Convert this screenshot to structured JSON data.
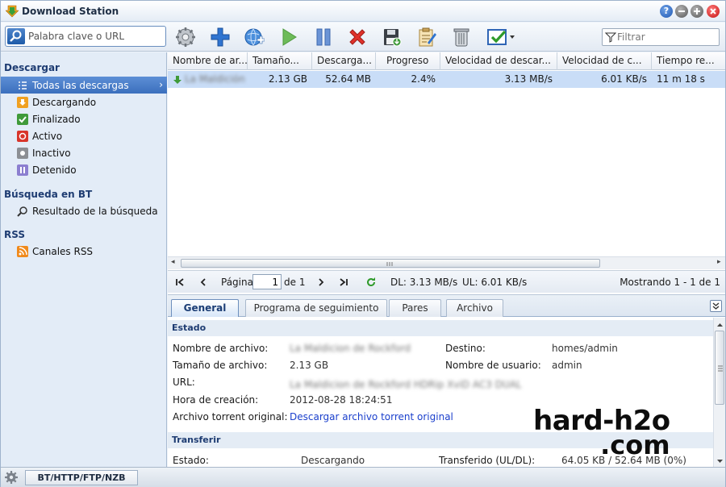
{
  "app": {
    "title": "Download Station"
  },
  "window_controls": {
    "help": "?"
  },
  "toolbar": {
    "search_placeholder": "Palabra clave o URL",
    "filter_placeholder": "Filtrar",
    "buttons": [
      "settings-icon",
      "add-icon",
      "add-url-icon",
      "resume-icon",
      "pause-icon",
      "delete-icon",
      "save-icon",
      "edit-icon",
      "clear-icon",
      "select-icon"
    ]
  },
  "sidebar": {
    "download_heading": "Descargar",
    "download_items": [
      {
        "label": "Todas las descargas",
        "icon": "list-icon",
        "selected": true
      },
      {
        "label": "Descargando",
        "icon": "downloading-icon"
      },
      {
        "label": "Finalizado",
        "icon": "finished-icon"
      },
      {
        "label": "Activo",
        "icon": "active-icon"
      },
      {
        "label": "Inactivo",
        "icon": "inactive-icon"
      },
      {
        "label": "Detenido",
        "icon": "stopped-icon"
      }
    ],
    "bt_heading": "Búsqueda en BT",
    "bt_items": [
      {
        "label": "Resultado de la búsqueda",
        "icon": "search-icon"
      }
    ],
    "rss_heading": "RSS",
    "rss_items": [
      {
        "label": "Canales RSS",
        "icon": "rss-icon"
      }
    ]
  },
  "table": {
    "columns": [
      "Nombre de ar...",
      "Tamaño...",
      "Descarga...",
      "Progreso",
      "Velocidad de descar...",
      "Velocidad de c...",
      "Tiempo re..."
    ],
    "rows": [
      {
        "name": "La Maldición",
        "size": "2.13 GB",
        "downloaded": "52.64 MB",
        "progress": "2.4%",
        "download_speed": "3.13 MB/s",
        "upload_speed": "6.01 KB/s",
        "time_left": "11 m 18 s"
      }
    ]
  },
  "pager": {
    "page_label": "Página",
    "page_value": "1",
    "of_label": "de 1",
    "dl_speed": "DL: 3.13 MB/s",
    "ul_speed": "UL: 6.01 KB/s",
    "showing": "Mostrando 1 - 1 de 1"
  },
  "details": {
    "tabs": [
      "General",
      "Programa de seguimiento",
      "Pares",
      "Archivo"
    ],
    "estado_heading": "Estado",
    "file_name_label": "Nombre de archivo:",
    "file_name_value": "La Maldicion de Rockford",
    "size_label": "Tamaño de archivo:",
    "size_value": "2.13 GB",
    "url_label": "URL:",
    "url_value": "La Maldicion de Rockford HDRip XviD AC3 DUAL",
    "created_label": "Hora de creación:",
    "created_value": "2012-08-28 18:24:51",
    "torrent_label": "Archivo torrent original:",
    "torrent_link": "Descargar archivo torrent original",
    "dest_label": "Destino:",
    "dest_value": "homes/admin",
    "user_label": "Nombre de usuario:",
    "user_value": "admin",
    "transfer_heading": "Transferir",
    "status_label": "Estado:",
    "status_value": "Descargando",
    "transferred_label": "Transferido (UL/DL):",
    "transferred_value": "64.05 KB / 52.64 MB (0%)"
  },
  "watermark": {
    "line1": "hard-h2o",
    "line2": ".com"
  },
  "statusbar": {
    "button": "BT/HTTP/FTP/NZB"
  }
}
